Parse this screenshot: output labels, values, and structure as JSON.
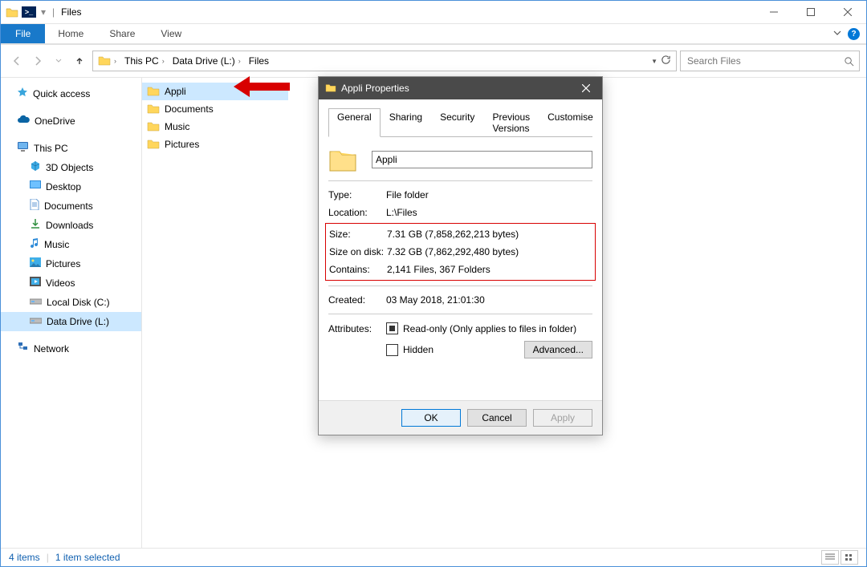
{
  "titlebar": {
    "title": "Files"
  },
  "ribbon": {
    "file": "File",
    "tabs": [
      "Home",
      "Share",
      "View"
    ]
  },
  "breadcrumb": [
    "This PC",
    "Data Drive (L:)",
    "Files"
  ],
  "search": {
    "placeholder": "Search Files"
  },
  "sidebar": {
    "quick_access": "Quick access",
    "onedrive": "OneDrive",
    "this_pc": "This PC",
    "children": [
      "3D Objects",
      "Desktop",
      "Documents",
      "Downloads",
      "Music",
      "Pictures",
      "Videos",
      "Local Disk (C:)",
      "Data Drive (L:)"
    ],
    "network": "Network"
  },
  "files": [
    "Appli",
    "Documents",
    "Music",
    "Pictures"
  ],
  "statusbar": {
    "count": "4 items",
    "selected": "1 item selected"
  },
  "dialog": {
    "title": "Appli Properties",
    "tabs": [
      "General",
      "Sharing",
      "Security",
      "Previous Versions",
      "Customise"
    ],
    "name_value": "Appli",
    "rows": {
      "type_label": "Type:",
      "type_value": "File folder",
      "location_label": "Location:",
      "location_value": "L:\\Files",
      "size_label": "Size:",
      "size_value": "7.31 GB (7,858,262,213 bytes)",
      "sizeondisk_label": "Size on disk:",
      "sizeondisk_value": "7.32 GB (7,862,292,480 bytes)",
      "contains_label": "Contains:",
      "contains_value": "2,141 Files, 367 Folders",
      "created_label": "Created:",
      "created_value": "03 May 2018, 21:01:30",
      "attributes_label": "Attributes:",
      "readonly_label": "Read-only (Only applies to files in folder)",
      "hidden_label": "Hidden",
      "advanced_label": "Advanced..."
    },
    "buttons": {
      "ok": "OK",
      "cancel": "Cancel",
      "apply": "Apply"
    }
  }
}
